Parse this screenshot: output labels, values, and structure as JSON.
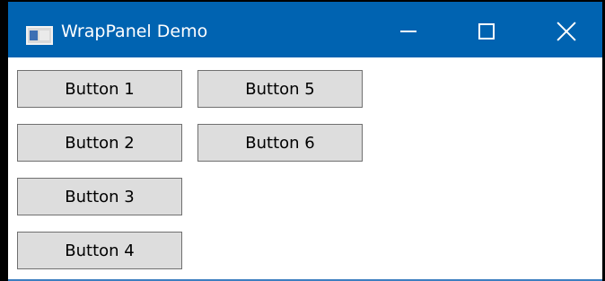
{
  "window": {
    "title": "WrapPanel Demo",
    "accent_color": "#0063b1",
    "icon": "app-window-icon",
    "controls": {
      "minimize_icon": "minimize-icon",
      "maximize_icon": "maximize-icon",
      "close_icon": "close-icon"
    }
  },
  "wrap_panel": {
    "buttons": [
      {
        "label": "Button 1"
      },
      {
        "label": "Button 2"
      },
      {
        "label": "Button 3"
      },
      {
        "label": "Button 4"
      },
      {
        "label": "Button 5"
      },
      {
        "label": "Button 6"
      }
    ]
  }
}
